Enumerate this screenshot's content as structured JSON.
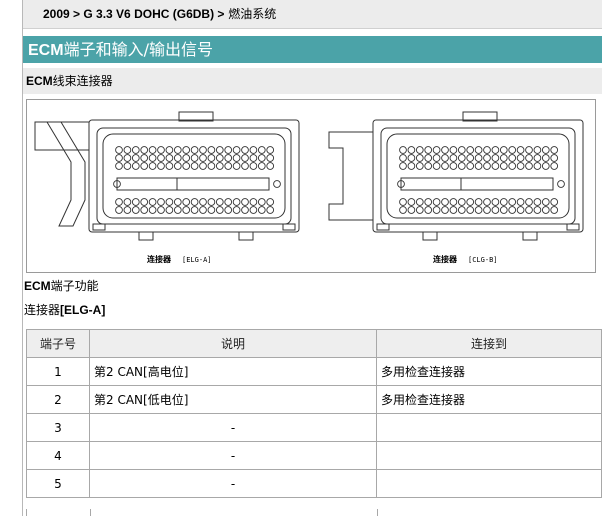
{
  "breadcrumb": {
    "bold": "2009 > G 3.3 V6 DOHC (G6DB) >",
    "rest": " 燃油系统"
  },
  "section": {
    "prefix": "ECM",
    "title": "端子和输入/输出信号"
  },
  "harness": {
    "prefix": "ECM",
    "label": "线束连接器"
  },
  "figure": {
    "left_caption": {
      "bold": "连接器",
      "code": "[ELG-A]"
    },
    "right_caption": {
      "bold": "连接器",
      "code": "[CLG-B]"
    }
  },
  "terminal_function": {
    "prefix": "ECM",
    "label": "端子功能"
  },
  "connector": {
    "prefix": "连接器",
    "code": "[ELG-A]"
  },
  "table": {
    "headers": [
      "端子号",
      "说明",
      "连接到"
    ],
    "rows": [
      {
        "num": "1",
        "desc": "第2 CAN[高电位]",
        "conn": "多用检查连接器"
      },
      {
        "num": "2",
        "desc": "第2 CAN[低电位]",
        "conn": "多用检查连接器"
      },
      {
        "num": "3",
        "desc": "-",
        "conn": ""
      },
      {
        "num": "4",
        "desc": "-",
        "conn": ""
      },
      {
        "num": "5",
        "desc": "-",
        "conn": ""
      }
    ]
  },
  "colors": {
    "title_bar": "#4ba3a8",
    "header_bg": "#eeeeee",
    "bar_bg": "#ececec"
  }
}
